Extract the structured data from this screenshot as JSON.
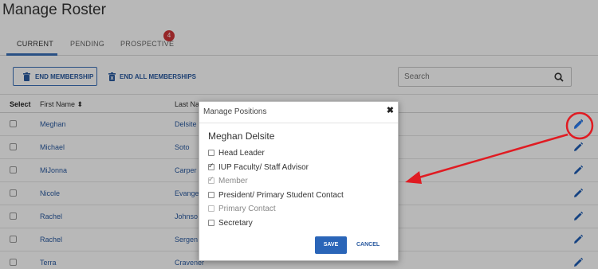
{
  "page": {
    "title": "Manage Roster"
  },
  "tabs": [
    {
      "label": "CURRENT"
    },
    {
      "label": "PENDING"
    },
    {
      "label": "PROSPECTIVE"
    }
  ],
  "badge": {
    "count": "4"
  },
  "actions": {
    "end_membership": "END MEMBERSHIP",
    "end_all": "END ALL MEMBERSHIPS"
  },
  "search": {
    "placeholder": "Search"
  },
  "table": {
    "headers": {
      "select": "Select",
      "first_name": "First Name ⬍",
      "last_name": "Last Na"
    },
    "rows": [
      {
        "first": "Meghan",
        "last": "Delsite"
      },
      {
        "first": "Michael",
        "last": "Soto"
      },
      {
        "first": "MiJonna",
        "last": "Carper"
      },
      {
        "first": "Nicole",
        "last": "Evange"
      },
      {
        "first": "Rachel",
        "last": "Johnso"
      },
      {
        "first": "Rachel",
        "last": "Sergen"
      },
      {
        "first": "Terra",
        "last": "Cravener"
      }
    ]
  },
  "modal": {
    "title": "Manage Positions",
    "close": "✖",
    "member_name": "Meghan Delsite",
    "options": [
      {
        "label": "Head Leader",
        "checked": false,
        "disabled": false
      },
      {
        "label": "IUP Faculty/ Staff Advisor",
        "checked": true,
        "disabled": false
      },
      {
        "label": "Member",
        "checked": true,
        "disabled": true
      },
      {
        "label": "President/ Primary Student Contact",
        "checked": false,
        "disabled": false
      },
      {
        "label": "Primary Contact",
        "checked": false,
        "disabled": true
      },
      {
        "label": "Secretary",
        "checked": false,
        "disabled": false
      }
    ],
    "save": "SAVE",
    "cancel": "CANCEL"
  },
  "colors": {
    "accent": "#2a65b8",
    "annotation": "#e01b22",
    "badge": "#d0363a"
  }
}
